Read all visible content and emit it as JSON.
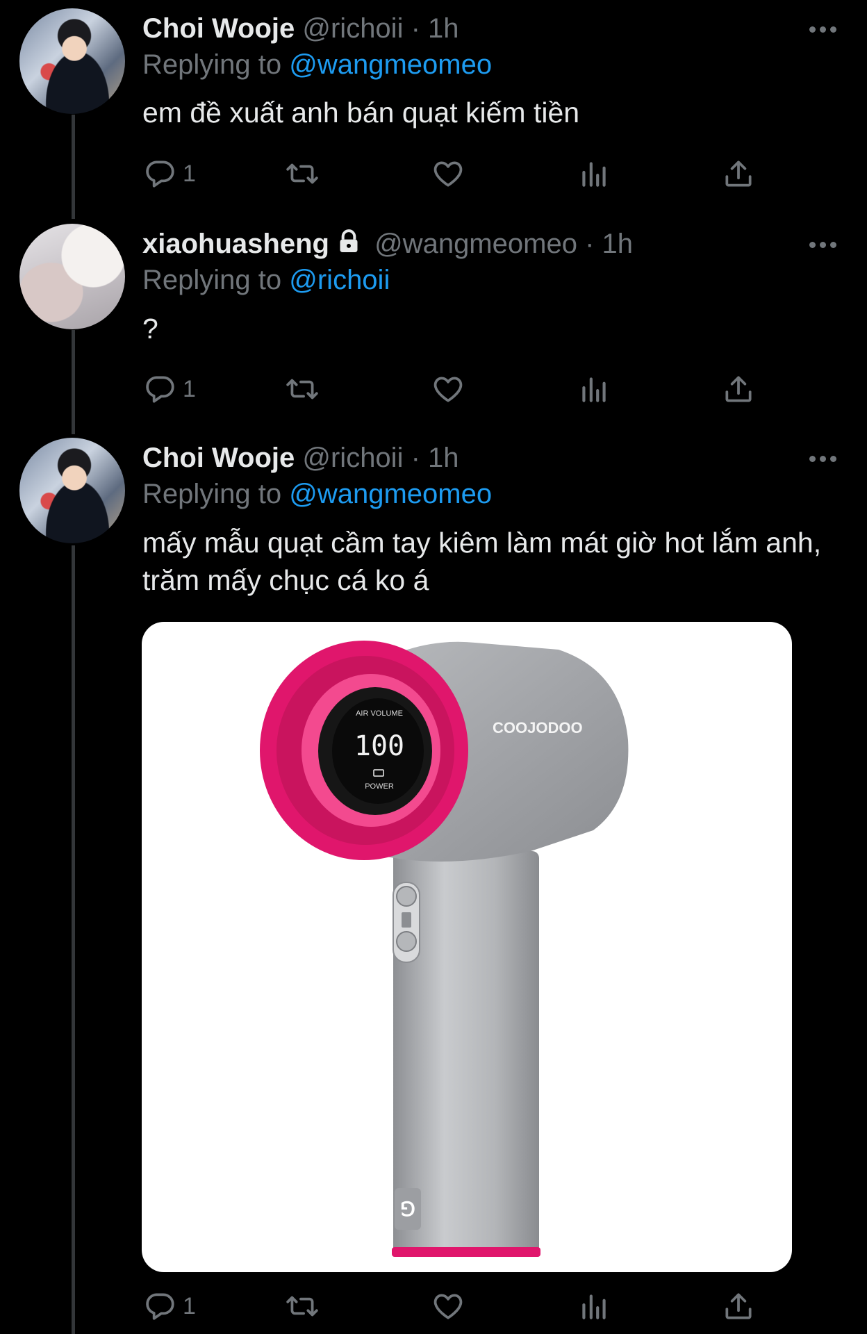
{
  "tweets": [
    {
      "name": "Choi Wooje",
      "handle": "@richoii",
      "time": "· 1h",
      "reply_prefix": "Replying to",
      "reply_to": "@wangmeomeo",
      "text": "em đề xuất anh bán quạt kiếm tiền",
      "reply_count": "1"
    },
    {
      "name": "xiaohuasheng",
      "handle": "@wangmeomeo",
      "time": "· 1h",
      "reply_prefix": "Replying to",
      "reply_to": "@richoii",
      "text": "?",
      "reply_count": "1"
    },
    {
      "name": "Choi Wooje",
      "handle": "@richoii",
      "time": "· 1h",
      "reply_prefix": "Replying to",
      "reply_to": "@wangmeomeo",
      "text": "mấy mẫu quạt cầm tay kiêm làm mát giờ hot lắm anh, trăm mấy chục cá ko á",
      "reply_count": "1"
    }
  ],
  "media": {
    "brand": "COOJODOO",
    "display_label_top": "AIR VOLUME",
    "display_value": "100",
    "display_label_bottom": "POWER",
    "handle_logo": "⅁"
  },
  "colors": {
    "background": "#000000",
    "text": "#e7e9ea",
    "muted": "#71767b",
    "link": "#1d9bf0",
    "fan_body": "#a7a9ac",
    "fan_accent": "#e0166c"
  }
}
